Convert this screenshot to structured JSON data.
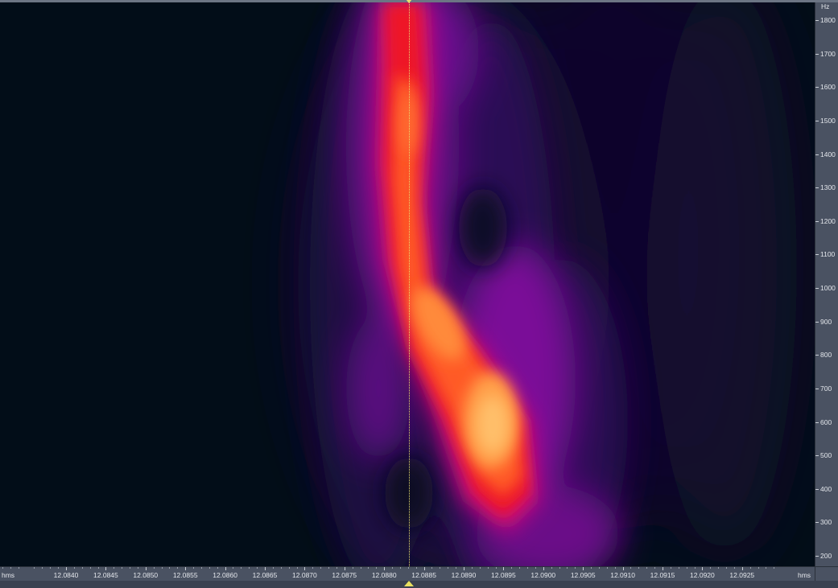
{
  "freq_axis": {
    "unit": "Hz",
    "ticks": [
      {
        "label": "1800",
        "value": 1800
      },
      {
        "label": "1700",
        "value": 1700
      },
      {
        "label": "1600",
        "value": 1600
      },
      {
        "label": "1500",
        "value": 1500
      },
      {
        "label": "1400",
        "value": 1400
      },
      {
        "label": "1300",
        "value": 1300
      },
      {
        "label": "1200",
        "value": 1200
      },
      {
        "label": "1100",
        "value": 1100
      },
      {
        "label": "1000",
        "value": 1000
      },
      {
        "label": "900",
        "value": 900
      },
      {
        "label": "800",
        "value": 800
      },
      {
        "label": "700",
        "value": 700
      },
      {
        "label": "600",
        "value": 600
      },
      {
        "label": "500",
        "value": 500
      },
      {
        "label": "400",
        "value": 400
      },
      {
        "label": "300",
        "value": 300
      },
      {
        "label": "200",
        "value": 200
      }
    ]
  },
  "time_axis": {
    "unit_left": "hms",
    "unit_right": "hms",
    "ticks": [
      {
        "label": "12.0840",
        "value": 12.084
      },
      {
        "label": "12.0845",
        "value": 12.0845
      },
      {
        "label": "12.0850",
        "value": 12.085
      },
      {
        "label": "12.0855",
        "value": 12.0855
      },
      {
        "label": "12.0860",
        "value": 12.086
      },
      {
        "label": "12.0865",
        "value": 12.0865
      },
      {
        "label": "12.0870",
        "value": 12.087
      },
      {
        "label": "12.0875",
        "value": 12.0875
      },
      {
        "label": "12.0880",
        "value": 12.088
      },
      {
        "label": "12.0885",
        "value": 12.0885
      },
      {
        "label": "12.0890",
        "value": 12.089
      },
      {
        "label": "12.0895",
        "value": 12.0895
      },
      {
        "label": "12.0900",
        "value": 12.09
      },
      {
        "label": "12.0905",
        "value": 12.0905
      },
      {
        "label": "12.0910",
        "value": 12.091
      },
      {
        "label": "12.0915",
        "value": 12.0915
      },
      {
        "label": "12.0920",
        "value": 12.092
      },
      {
        "label": "12.0925",
        "value": 12.0925
      }
    ]
  },
  "cursor": {
    "time_value": 12.08828
  },
  "colors": {
    "background": "#020d18",
    "cursor": "#e8e070",
    "ruler": "#4a5262"
  }
}
